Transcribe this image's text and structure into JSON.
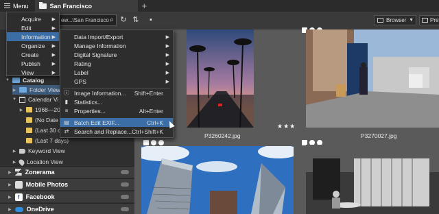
{
  "titlebar": {
    "menu_label": "Menu",
    "tab_label": "San Francisco"
  },
  "toolbar": {
    "path": "ew...\\San Francisco",
    "browser_label": "Browser",
    "preview_label": "Previ"
  },
  "sidebar": {
    "catalog_label": "Catalog",
    "folder_view": "Folder View",
    "calendar_view": "Calendar Vi",
    "year_item": "1968—20",
    "no_date": "(No Date",
    "last_30": "(Last 30 c",
    "last_7": "(Last 7 days)",
    "keyword_view": "Keyword View",
    "location_view": "Location View",
    "services": [
      "Zonerama",
      "Mobile Photos",
      "Facebook",
      "OneDrive"
    ]
  },
  "main_menu": [
    "Acquire",
    "Edit",
    "Information",
    "Organize",
    "Create",
    "Publish",
    "View"
  ],
  "info_menu": {
    "submenus": [
      "Data Import/Export",
      "Manage Information",
      "Digital Signature",
      "Rating",
      "Label",
      "GPS"
    ],
    "items": [
      {
        "label": "Image Information...",
        "shortcut": "Shift+Enter",
        "icon": "info-icon"
      },
      {
        "label": "Statistics...",
        "shortcut": "",
        "icon": "statistics-icon"
      },
      {
        "label": "Properties...",
        "shortcut": "Alt+Enter",
        "icon": "properties-icon"
      },
      {
        "label": "Batch Edit EXIF...",
        "shortcut": "Ctrl+K",
        "icon": "batch-edit-icon"
      },
      {
        "label": "Search and Replace...",
        "shortcut": "Ctrl+Shift+K",
        "icon": "search-replace-icon"
      }
    ]
  },
  "photos": [
    {
      "filename": "P3260242.jpg",
      "stars": "★★★"
    },
    {
      "filename": "P3270027.jpg",
      "stars": ""
    }
  ],
  "colors": {
    "highlight": "#3b6ea5",
    "folder": "#e7c35a",
    "selected_row": "#3d5a7a"
  }
}
